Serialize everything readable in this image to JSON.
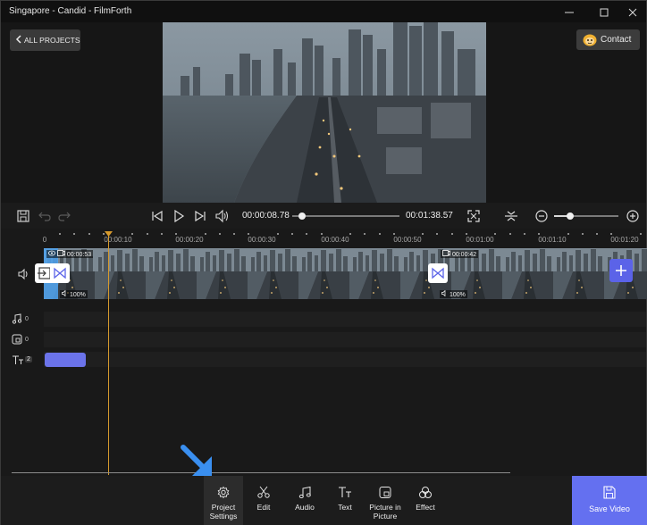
{
  "window": {
    "title": "Singapore - Candid - FilmForth",
    "minimize_icon": "minimize-icon",
    "maximize_icon": "maximize-icon",
    "close_icon": "close-icon"
  },
  "header": {
    "back_label": "ALL PROJECTS",
    "contact_label": "Contact"
  },
  "transport": {
    "current_time": "00:00:08.78",
    "total_time": "00:01:38.57",
    "seek_progress": 0.09,
    "zoom_level": 0.25,
    "icons": [
      "save-icon",
      "undo-icon",
      "redo-icon",
      "skip-start-icon",
      "play-icon",
      "skip-end-icon",
      "volume-icon",
      "fullscreen-icon",
      "split-icon",
      "zoom-out-icon",
      "zoom-in-icon"
    ]
  },
  "timeline": {
    "ruler_labels": [
      "0",
      "00:00:10",
      "00:00:20",
      "00:00:30",
      "00:00:40",
      "00:00:50",
      "00:01:00",
      "00:01:10",
      "00:01:20"
    ],
    "clips": [
      {
        "duration": "00:00:53",
        "speed": "100%"
      },
      {
        "duration": "00:00:42",
        "speed": "100%"
      }
    ],
    "tracks": {
      "audio_count": "0",
      "overlay_count": "0",
      "text_count": "2"
    }
  },
  "toolbar": {
    "items": [
      {
        "label_line1": "Project",
        "label_line2": "Settings",
        "icon": "gear-icon"
      },
      {
        "label_line1": "Edit",
        "label_line2": "",
        "icon": "scissors-icon"
      },
      {
        "label_line1": "Audio",
        "label_line2": "",
        "icon": "music-note-icon"
      },
      {
        "label_line1": "Text",
        "label_line2": "",
        "icon": "text-icon"
      },
      {
        "label_line1": "Picture in",
        "label_line2": "Picture",
        "icon": "picture-in-picture-icon"
      },
      {
        "label_line1": "Effect",
        "label_line2": "",
        "icon": "effect-icon"
      }
    ],
    "save_label": "Save Video"
  },
  "colors": {
    "accent": "#6470f0",
    "playhead": "#d69a2d",
    "annotation_arrow": "#3a8ff0"
  }
}
